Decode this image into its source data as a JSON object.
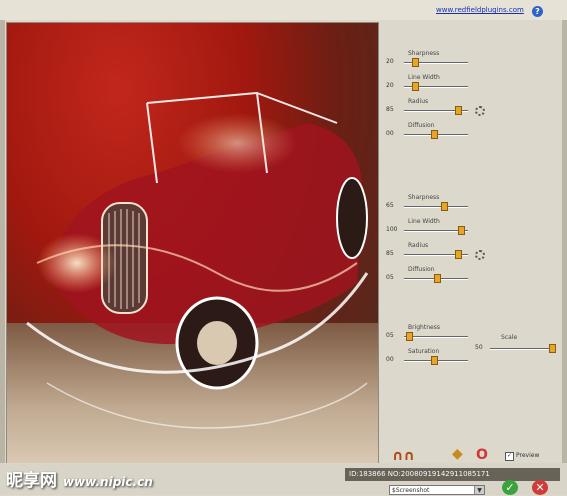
{
  "header": {
    "link_text": "www.redfieldplugins.com",
    "help_label": "?"
  },
  "panel": {
    "group1": [
      {
        "caption": "Sharpness",
        "value": "20",
        "fraction": 0.14
      },
      {
        "caption": "Line Width",
        "value": "20",
        "fraction": 0.14
      },
      {
        "caption": "Radius",
        "value": "85",
        "fraction": 0.85
      },
      {
        "caption": "Diffusion",
        "value": "00",
        "fraction": 0.45
      }
    ],
    "group2": [
      {
        "caption": "Sharpness",
        "value": "65",
        "fraction": 0.62
      },
      {
        "caption": "Line Width",
        "value": "100",
        "fraction": 0.9
      },
      {
        "caption": "Radius",
        "value": "85",
        "fraction": 0.85
      },
      {
        "caption": "Diffusion",
        "value": "05",
        "fraction": 0.5
      }
    ],
    "group3": [
      {
        "caption": "Brightness",
        "value": "05",
        "fraction": 0.03
      },
      {
        "caption": "Saturation",
        "value": "00",
        "fraction": 0.45
      }
    ],
    "scale": {
      "caption": "Scale",
      "value": "50",
      "fraction": 0.95
    }
  },
  "toolbar": {
    "preview_label": "Preview",
    "preview_checked": "✓",
    "preset_value": "$Screenshot",
    "ok_label": "✓",
    "cancel_label": "✕",
    "tool1_label": "∩∩",
    "tool2_label": "◆",
    "tool3_label": "O"
  },
  "watermark": {
    "brand": "昵享网",
    "url": "www.nipic.cn"
  },
  "idtag": "ID:183866 NO:20080919142911085171"
}
